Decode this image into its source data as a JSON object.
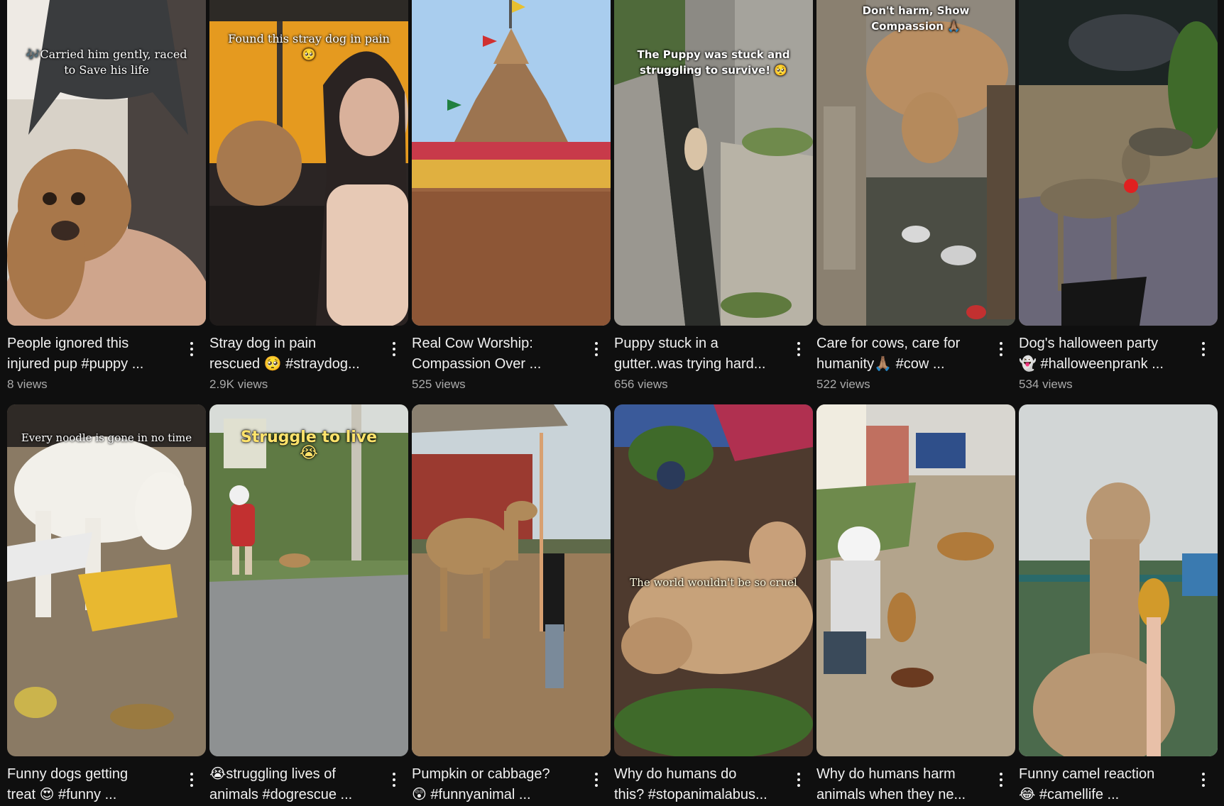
{
  "shorts": [
    {
      "title": "People ignored this\ninjured pup #puppy ...",
      "views": "8 views",
      "overlay": "🎶Carried him gently, raced to Save his life",
      "colors": [
        "#d8d2c8",
        "#a8774a",
        "#3b3b3b"
      ]
    },
    {
      "title": "Stray dog in pain\nrescued 🥺 #straydog...",
      "views": "2.9K views",
      "overlay": "Found this stray dog in pain🥺",
      "colors": [
        "#f0a020",
        "#2b2524",
        "#e7c9b5"
      ]
    },
    {
      "title": "Real Cow Worship:\nCompassion Over ...",
      "views": "525 views",
      "overlay": "",
      "colors": [
        "#a9cdee",
        "#b77a4c",
        "#8d5636"
      ]
    },
    {
      "title": "Puppy stuck in a\ngutter..was trying hard...",
      "views": "656 views",
      "overlay": "The Puppy was stuck and struggling to survive! 🥺",
      "colors": [
        "#8c8a84",
        "#2b2d2a",
        "#6f7a55"
      ]
    },
    {
      "title": "Care for cows, care for\nhumanity🙏🏽 #cow ...",
      "views": "522 views",
      "overlay": "Don't harm, Show Compassion 🙏🏽",
      "colors": [
        "#9a8f80",
        "#b98e62",
        "#4b4d44"
      ]
    },
    {
      "title": "Dog's halloween party\n👻 #halloweenprank ...",
      "views": "534 views",
      "overlay": "",
      "colors": [
        "#1d2524",
        "#7a6d56",
        "#6a6778"
      ]
    },
    {
      "title": "Funny dogs getting\ntreat 😍 #funny ...",
      "views": "",
      "overlay": "Every noodle is gone in no time",
      "colors": [
        "#8a7a64",
        "#f2f0ea",
        "#e8b830"
      ]
    },
    {
      "title": "😭struggling lives of\nanimals #dogrescue ...",
      "views": "",
      "overlay": "Struggle to live\n😭",
      "colors": [
        "#6f8a52",
        "#8e9192",
        "#b38a57"
      ]
    },
    {
      "title": "Pumpkin or cabbage?\n😲 #funnyanimal ...",
      "views": "",
      "overlay": "",
      "colors": [
        "#c9d3d8",
        "#9b3a30",
        "#9a7c5a"
      ]
    },
    {
      "title": "Why do humans do\nthis? #stopanimalabus...",
      "views": "",
      "overlay": "The world wouldn't be so cruel",
      "colors": [
        "#4e3a2e",
        "#c7a27a",
        "#3f6a2a"
      ]
    },
    {
      "title": "Why do humans harm\nanimals when they ne...",
      "views": "",
      "overlay": "",
      "colors": [
        "#d8d6d0",
        "#b3a48c",
        "#6e8a4c"
      ]
    },
    {
      "title": "Funny camel reaction\n😂 #camellife ...",
      "views": "",
      "overlay": "",
      "colors": [
        "#d2d6d6",
        "#b89773",
        "#4b6a4c"
      ]
    }
  ]
}
